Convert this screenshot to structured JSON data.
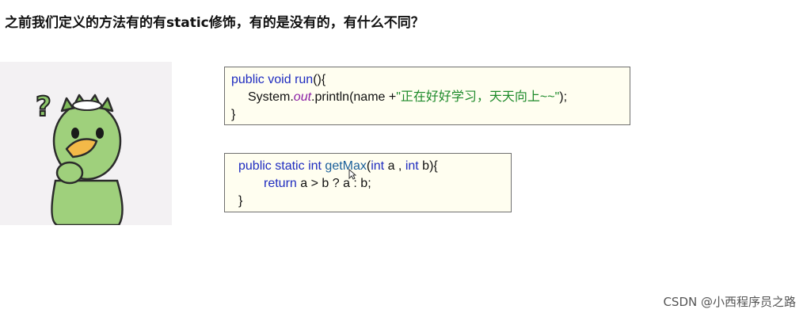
{
  "title": "之前我们定义的方法有的有static修饰，有的是没有的，有什么不同？",
  "illustration": {
    "icon": "confused-kappa-character-icon",
    "mark": "?"
  },
  "code_block_1": {
    "line1": {
      "kw1": "public",
      "kw2": "void",
      "name": "run",
      "rest": "(){"
    },
    "line2": {
      "obj": "System.",
      "field": "out",
      "mid": ".println(name +",
      "str": "\"正在好好学习，天天向上~~\"",
      "end": ");"
    },
    "line3": "}"
  },
  "code_block_2": {
    "line1": {
      "kw1": "public",
      "kw2": "static",
      "kw3": "int",
      "name": "getMax",
      "p1": "int",
      "a": " a , ",
      "p2": "int",
      "b": " b){"
    },
    "line2": {
      "kw": "return",
      "expr": " a > b ? a : b;"
    },
    "line3": "}"
  },
  "watermark": "CSDN @小西程序员之路",
  "colors": {
    "keyword": "#1f2cc0",
    "string": "#1d8a2a",
    "field": "#8b1fa5",
    "box_bg": "#fffef0",
    "character": "#8cc56a"
  }
}
